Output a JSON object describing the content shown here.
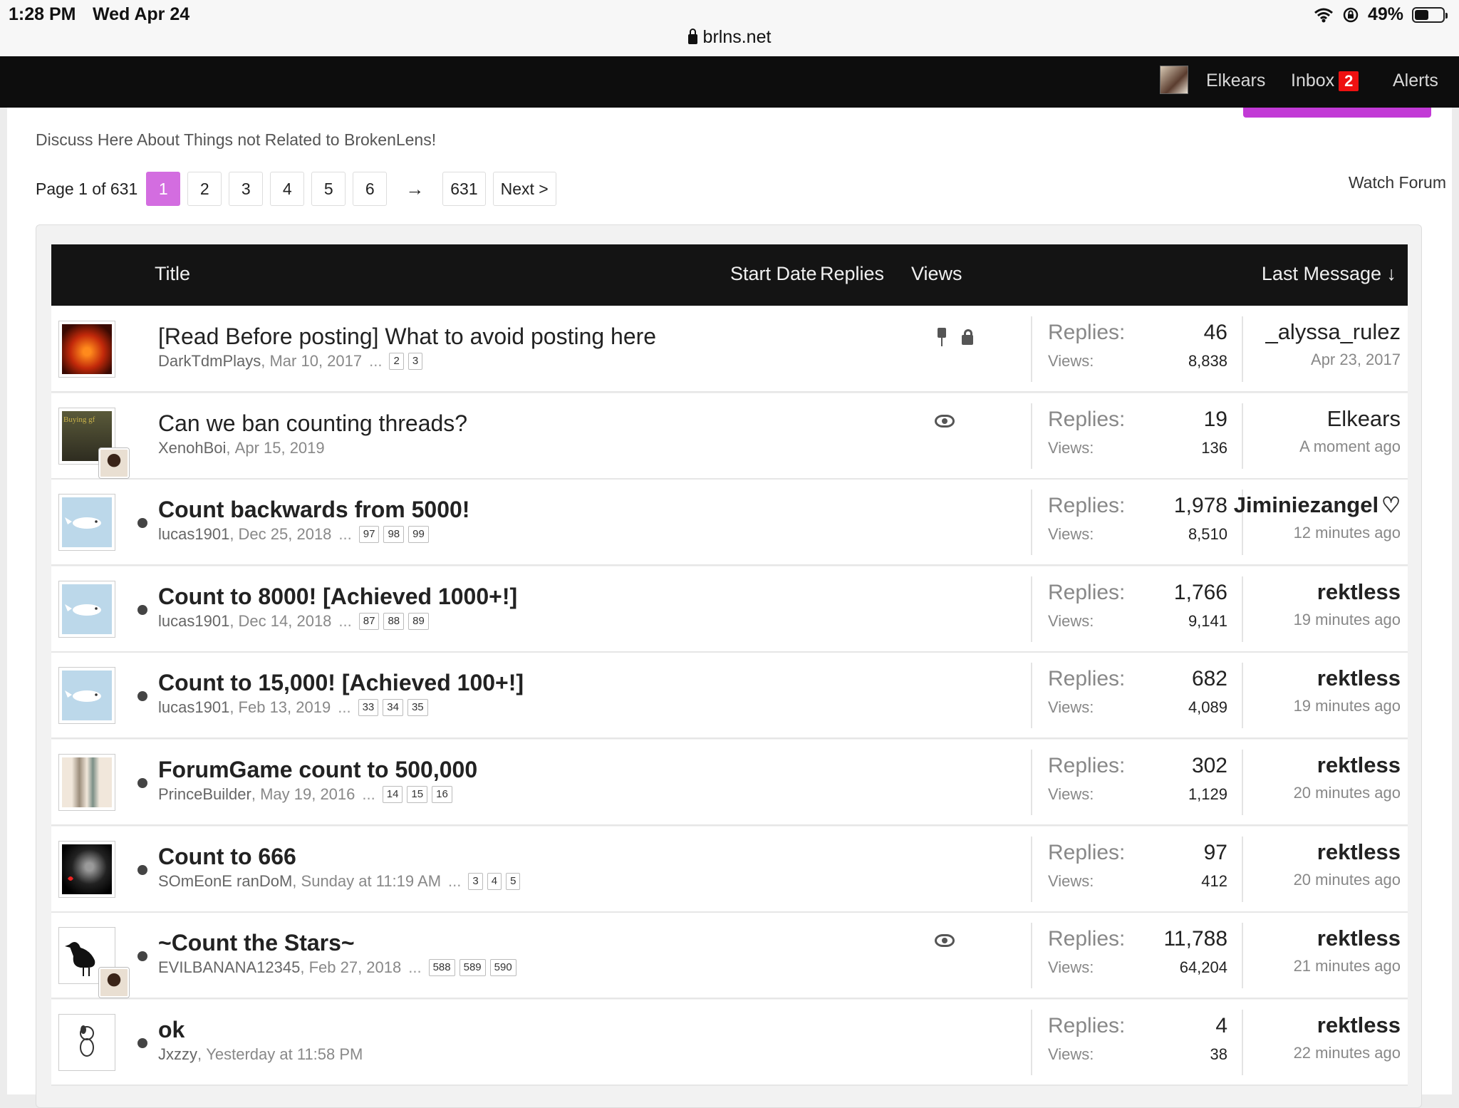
{
  "status_bar": {
    "time": "1:28 PM",
    "date": "Wed Apr 24",
    "battery": "49%",
    "battery_level": 0.49,
    "url": "brlns.net"
  },
  "topnav": {
    "username": "Elkears",
    "inbox_label": "Inbox",
    "inbox_count": "2",
    "alerts_label": "Alerts"
  },
  "forum": {
    "description": "Discuss Here About Things not Related to BrokenLens!",
    "watch_label": "Watch Forum"
  },
  "pagination": {
    "label": "Page 1 of 631",
    "pages": [
      "1",
      "2",
      "3",
      "4",
      "5",
      "6"
    ],
    "arrow": "→",
    "last_page": "631",
    "next": "Next >"
  },
  "table_header": {
    "title": "Title",
    "start_date": "Start Date",
    "replies": "Replies",
    "views": "Views",
    "last_message": "Last Message ↓"
  },
  "labels": {
    "replies": "Replies:",
    "views": "Views:",
    "ellipsis": "..."
  },
  "threads": [
    {
      "title": "[Read Before posting] What to avoid posting here",
      "author": "DarkTdmPlays",
      "date": "Mar 10, 2017",
      "pages": [
        "2",
        "3"
      ],
      "replies": "46",
      "views": "8,838",
      "last_user": "_alyssa_rulez",
      "last_time": "Apr 23, 2017",
      "unread": false,
      "icons": [
        "pin-icon",
        "lock-icon"
      ]
    },
    {
      "title": "Can we ban counting threads?",
      "author": "XenohBoi",
      "date": "Apr 15, 2019",
      "pages": [],
      "replies": "19",
      "views": "136",
      "last_user": "Elkears",
      "last_time": "A moment ago",
      "unread": false,
      "icons": [
        "eye-icon"
      ]
    },
    {
      "title": "Count backwards from 5000!",
      "author": "lucas1901",
      "date": "Dec 25, 2018",
      "pages": [
        "97",
        "98",
        "99"
      ],
      "replies": "1,978",
      "views": "8,510",
      "last_user": "Jiminiezangel",
      "last_time": "12 minutes ago",
      "unread": true,
      "icons": []
    },
    {
      "title": "Count to 8000! [Achieved 1000+!]",
      "author": "lucas1901",
      "date": "Dec 14, 2018",
      "pages": [
        "87",
        "88",
        "89"
      ],
      "replies": "1,766",
      "views": "9,141",
      "last_user": "rektless",
      "last_time": "19 minutes ago",
      "unread": true,
      "icons": []
    },
    {
      "title": "Count to 15,000! [Achieved 100+!]",
      "author": "lucas1901",
      "date": "Feb 13, 2019",
      "pages": [
        "33",
        "34",
        "35"
      ],
      "replies": "682",
      "views": "4,089",
      "last_user": "rektless",
      "last_time": "19 minutes ago",
      "unread": true,
      "icons": []
    },
    {
      "title": "ForumGame count to 500,000",
      "author": "PrinceBuilder",
      "date": "May 19, 2016",
      "pages": [
        "14",
        "15",
        "16"
      ],
      "replies": "302",
      "views": "1,129",
      "last_user": "rektless",
      "last_time": "20 minutes ago",
      "unread": true,
      "icons": []
    },
    {
      "title": "Count to 666",
      "author": "SOmEonE ranDoM",
      "date": "Sunday at 11:19 AM",
      "pages": [
        "3",
        "4",
        "5"
      ],
      "replies": "97",
      "views": "412",
      "last_user": "rektless",
      "last_time": "20 minutes ago",
      "unread": true,
      "icons": []
    },
    {
      "title": "~Count the Stars~",
      "author": "EVILBANANA12345",
      "date": "Feb 27, 2018",
      "pages": [
        "588",
        "589",
        "590"
      ],
      "replies": "11,788",
      "views": "64,204",
      "last_user": "rektless",
      "last_time": "21 minutes ago",
      "unread": true,
      "icons": [
        "eye-icon"
      ]
    },
    {
      "title": "ok",
      "author": "Jxzzy",
      "date": "Yesterday at 11:58 PM",
      "pages": [],
      "replies": "4",
      "views": "38",
      "last_user": "rektless",
      "last_time": "22 minutes ago",
      "unread": true,
      "icons": []
    }
  ]
}
